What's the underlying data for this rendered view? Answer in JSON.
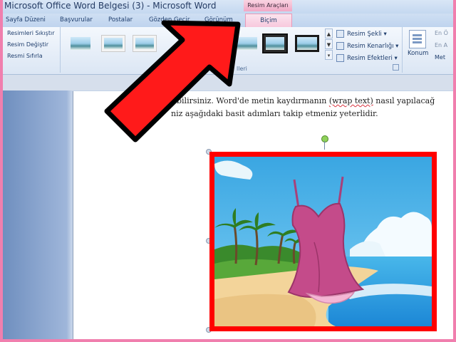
{
  "window": {
    "title": "Microsoft Office Word Belgesi (3) - Microsoft Word",
    "context_tab_group": "Resim Araçları"
  },
  "tabs": [
    {
      "label": "Sayfa Düzeni"
    },
    {
      "label": "Başvurular"
    },
    {
      "label": "Postalar"
    },
    {
      "label": "Gözden Geçir"
    },
    {
      "label": "Görünüm"
    },
    {
      "label": "Biçim",
      "active": true
    }
  ],
  "ribbon": {
    "adjust": {
      "compress": "Resimleri Sıkıştır",
      "change": "Resim Değiştir",
      "reset": "Resmi Sıfırla"
    },
    "styles": {
      "group_label_fragment": "lleri",
      "shape": "Resim Şekli",
      "border": "Resim Kenarlığı",
      "effects": "Resim Efektleri"
    },
    "arrange": {
      "position": "Konum",
      "item1": "En Ö",
      "item2": "En A",
      "item3": "Met"
    }
  },
  "document": {
    "line1_a": "bilirsiniz. Word'de metin kaydırmanın ",
    "line1_wrap": "(wrap text)",
    "line1_b": " nasıl yapılacağ",
    "line2": "niz aşağıdaki basit adımları takip etmeniz yeterlidir."
  },
  "colors": {
    "arrow": "#ff1a1a",
    "picture_border": "#ff0000",
    "frame": "#f07fae"
  }
}
